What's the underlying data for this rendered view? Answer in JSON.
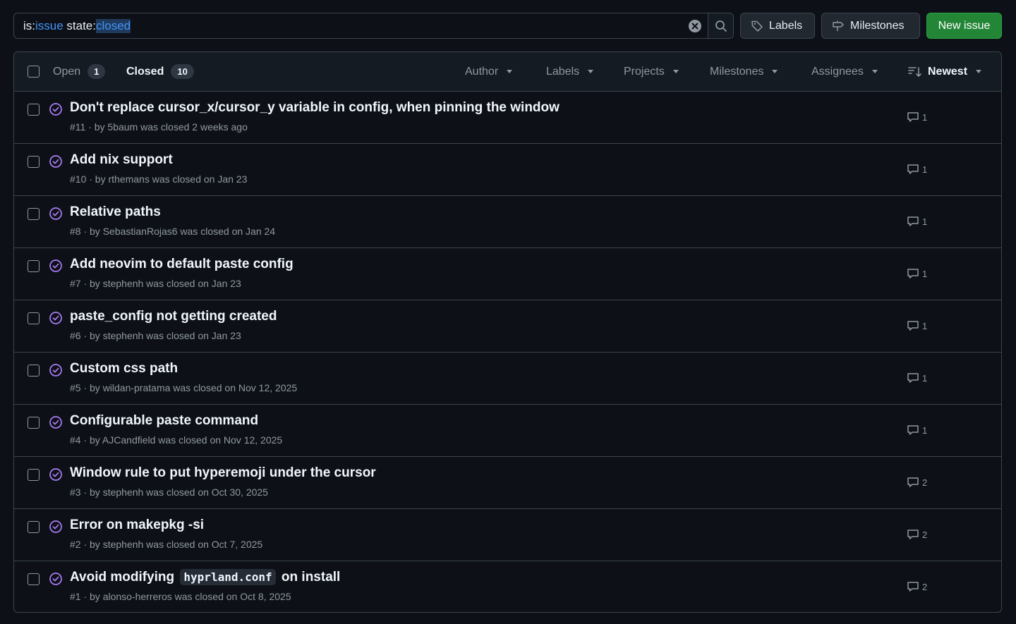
{
  "search": {
    "prefix1": "is:",
    "token1": "issue",
    "prefix2": " state:",
    "token2": "closed"
  },
  "toolbar": {
    "labels_label": "Labels",
    "milestones_label": "Milestones",
    "new_issue_label": "New issue"
  },
  "tabs": {
    "open_label": "Open",
    "open_count": "1",
    "closed_label": "Closed",
    "closed_count": "10"
  },
  "filters": {
    "author": "Author",
    "labels": "Labels",
    "projects": "Projects",
    "milestones": "Milestones",
    "assignees": "Assignees",
    "sort": "Newest"
  },
  "issues": [
    {
      "title": "Don't replace cursor_x/cursor_y variable in config, when pinning the window",
      "meta": "#11 · by 5baum was closed 2 weeks ago",
      "comments": "1"
    },
    {
      "title": "Add nix support",
      "meta": "#10 · by rthemans was closed on Jan 23",
      "comments": "1"
    },
    {
      "title": "Relative paths",
      "meta": "#8 · by SebastianRojas6 was closed on Jan 24",
      "comments": "1"
    },
    {
      "title": "Add neovim to default paste config",
      "meta": "#7 · by stephenh was closed on Jan 23",
      "comments": "1"
    },
    {
      "title": "paste_config not getting created",
      "meta": "#6 · by stephenh was closed on Jan 23",
      "comments": "1"
    },
    {
      "title": "Custom css path",
      "meta": "#5 · by wildan-pratama was closed on Nov 12, 2025",
      "comments": "1"
    },
    {
      "title": "Configurable paste command",
      "meta": "#4 · by AJCandfield was closed on Nov 12, 2025",
      "comments": "1"
    },
    {
      "title": "Window rule to put hyperemoji under the cursor",
      "meta": "#3 · by stephenh was closed on Oct 30, 2025",
      "comments": "2"
    },
    {
      "title": "Error on makepkg -si",
      "meta": "#2 · by stephenh was closed on Oct 7, 2025",
      "comments": "2"
    },
    {
      "title_before": "Avoid modifying",
      "title_code": "hyprland.conf",
      "title_after": "on install",
      "meta": "#1 · by alonso-herreros was closed on Oct 8, 2025",
      "comments": "2"
    }
  ],
  "colors": {
    "closed_icon": "#ab7df8",
    "accent_blue": "#4493f8",
    "new_issue_green": "#238636"
  },
  "icons": {
    "closed_state": "issue-closed-icon",
    "comment": "comment-icon",
    "tag": "tag-icon",
    "milestone": "milestone-icon",
    "search": "search-icon",
    "clear": "clear-icon",
    "sort": "sort-icon"
  }
}
